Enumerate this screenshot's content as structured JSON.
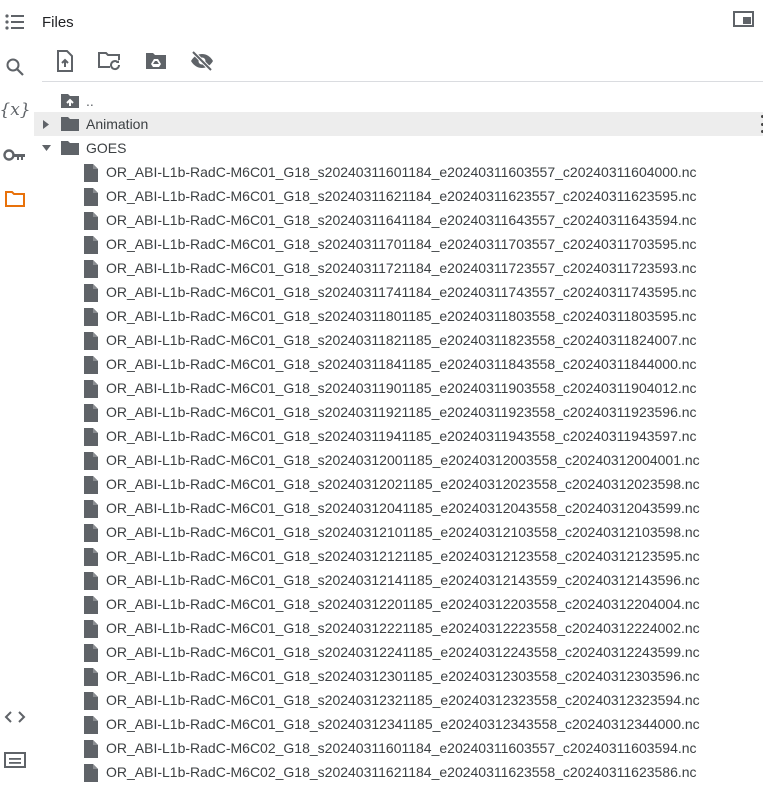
{
  "panel": {
    "title": "Files"
  },
  "sidebar": {
    "icons": [
      "table-of-contents-icon",
      "search-icon",
      "variables-icon",
      "secrets-key-icon",
      "files-folder-icon",
      "code-snippets-icon",
      "terminal-icon"
    ],
    "active_color": "#e8710a"
  },
  "toolbar": {
    "icons": [
      "upload-file-icon",
      "refresh-folder-icon",
      "mount-drive-icon",
      "hide-hidden-files-icon"
    ]
  },
  "tree": {
    "parent": "..",
    "folders": [
      {
        "name": "Animation",
        "expanded": false
      },
      {
        "name": "GOES",
        "expanded": true
      }
    ],
    "files": [
      "OR_ABI-L1b-RadC-M6C01_G18_s20240311601184_e20240311603557_c20240311604000.nc",
      "OR_ABI-L1b-RadC-M6C01_G18_s20240311621184_e20240311623557_c20240311623595.nc",
      "OR_ABI-L1b-RadC-M6C01_G18_s20240311641184_e20240311643557_c20240311643594.nc",
      "OR_ABI-L1b-RadC-M6C01_G18_s20240311701184_e20240311703557_c20240311703595.nc",
      "OR_ABI-L1b-RadC-M6C01_G18_s20240311721184_e20240311723557_c20240311723593.nc",
      "OR_ABI-L1b-RadC-M6C01_G18_s20240311741184_e20240311743557_c20240311743595.nc",
      "OR_ABI-L1b-RadC-M6C01_G18_s20240311801185_e20240311803558_c20240311803595.nc",
      "OR_ABI-L1b-RadC-M6C01_G18_s20240311821185_e20240311823558_c20240311824007.nc",
      "OR_ABI-L1b-RadC-M6C01_G18_s20240311841185_e20240311843558_c20240311844000.nc",
      "OR_ABI-L1b-RadC-M6C01_G18_s20240311901185_e20240311903558_c20240311904012.nc",
      "OR_ABI-L1b-RadC-M6C01_G18_s20240311921185_e20240311923558_c20240311923596.nc",
      "OR_ABI-L1b-RadC-M6C01_G18_s20240311941185_e20240311943558_c20240311943597.nc",
      "OR_ABI-L1b-RadC-M6C01_G18_s20240312001185_e20240312003558_c20240312004001.nc",
      "OR_ABI-L1b-RadC-M6C01_G18_s20240312021185_e20240312023558_c20240312023598.nc",
      "OR_ABI-L1b-RadC-M6C01_G18_s20240312041185_e20240312043558_c20240312043599.nc",
      "OR_ABI-L1b-RadC-M6C01_G18_s20240312101185_e20240312103558_c20240312103598.nc",
      "OR_ABI-L1b-RadC-M6C01_G18_s20240312121185_e20240312123558_c20240312123595.nc",
      "OR_ABI-L1b-RadC-M6C01_G18_s20240312141185_e20240312143559_c20240312143596.nc",
      "OR_ABI-L1b-RadC-M6C01_G18_s20240312201185_e20240312203558_c20240312204004.nc",
      "OR_ABI-L1b-RadC-M6C01_G18_s20240312221185_e20240312223558_c20240312224002.nc",
      "OR_ABI-L1b-RadC-M6C01_G18_s20240312241185_e20240312243558_c20240312243599.nc",
      "OR_ABI-L1b-RadC-M6C01_G18_s20240312301185_e20240312303558_c20240312303596.nc",
      "OR_ABI-L1b-RadC-M6C01_G18_s20240312321185_e20240312323558_c20240312323594.nc",
      "OR_ABI-L1b-RadC-M6C01_G18_s20240312341185_e20240312343558_c20240312344000.nc",
      "OR_ABI-L1b-RadC-M6C02_G18_s20240311601184_e20240311603557_c20240311603594.nc",
      "OR_ABI-L1b-RadC-M6C02_G18_s20240311621184_e20240311623558_c20240311623586.nc"
    ]
  }
}
